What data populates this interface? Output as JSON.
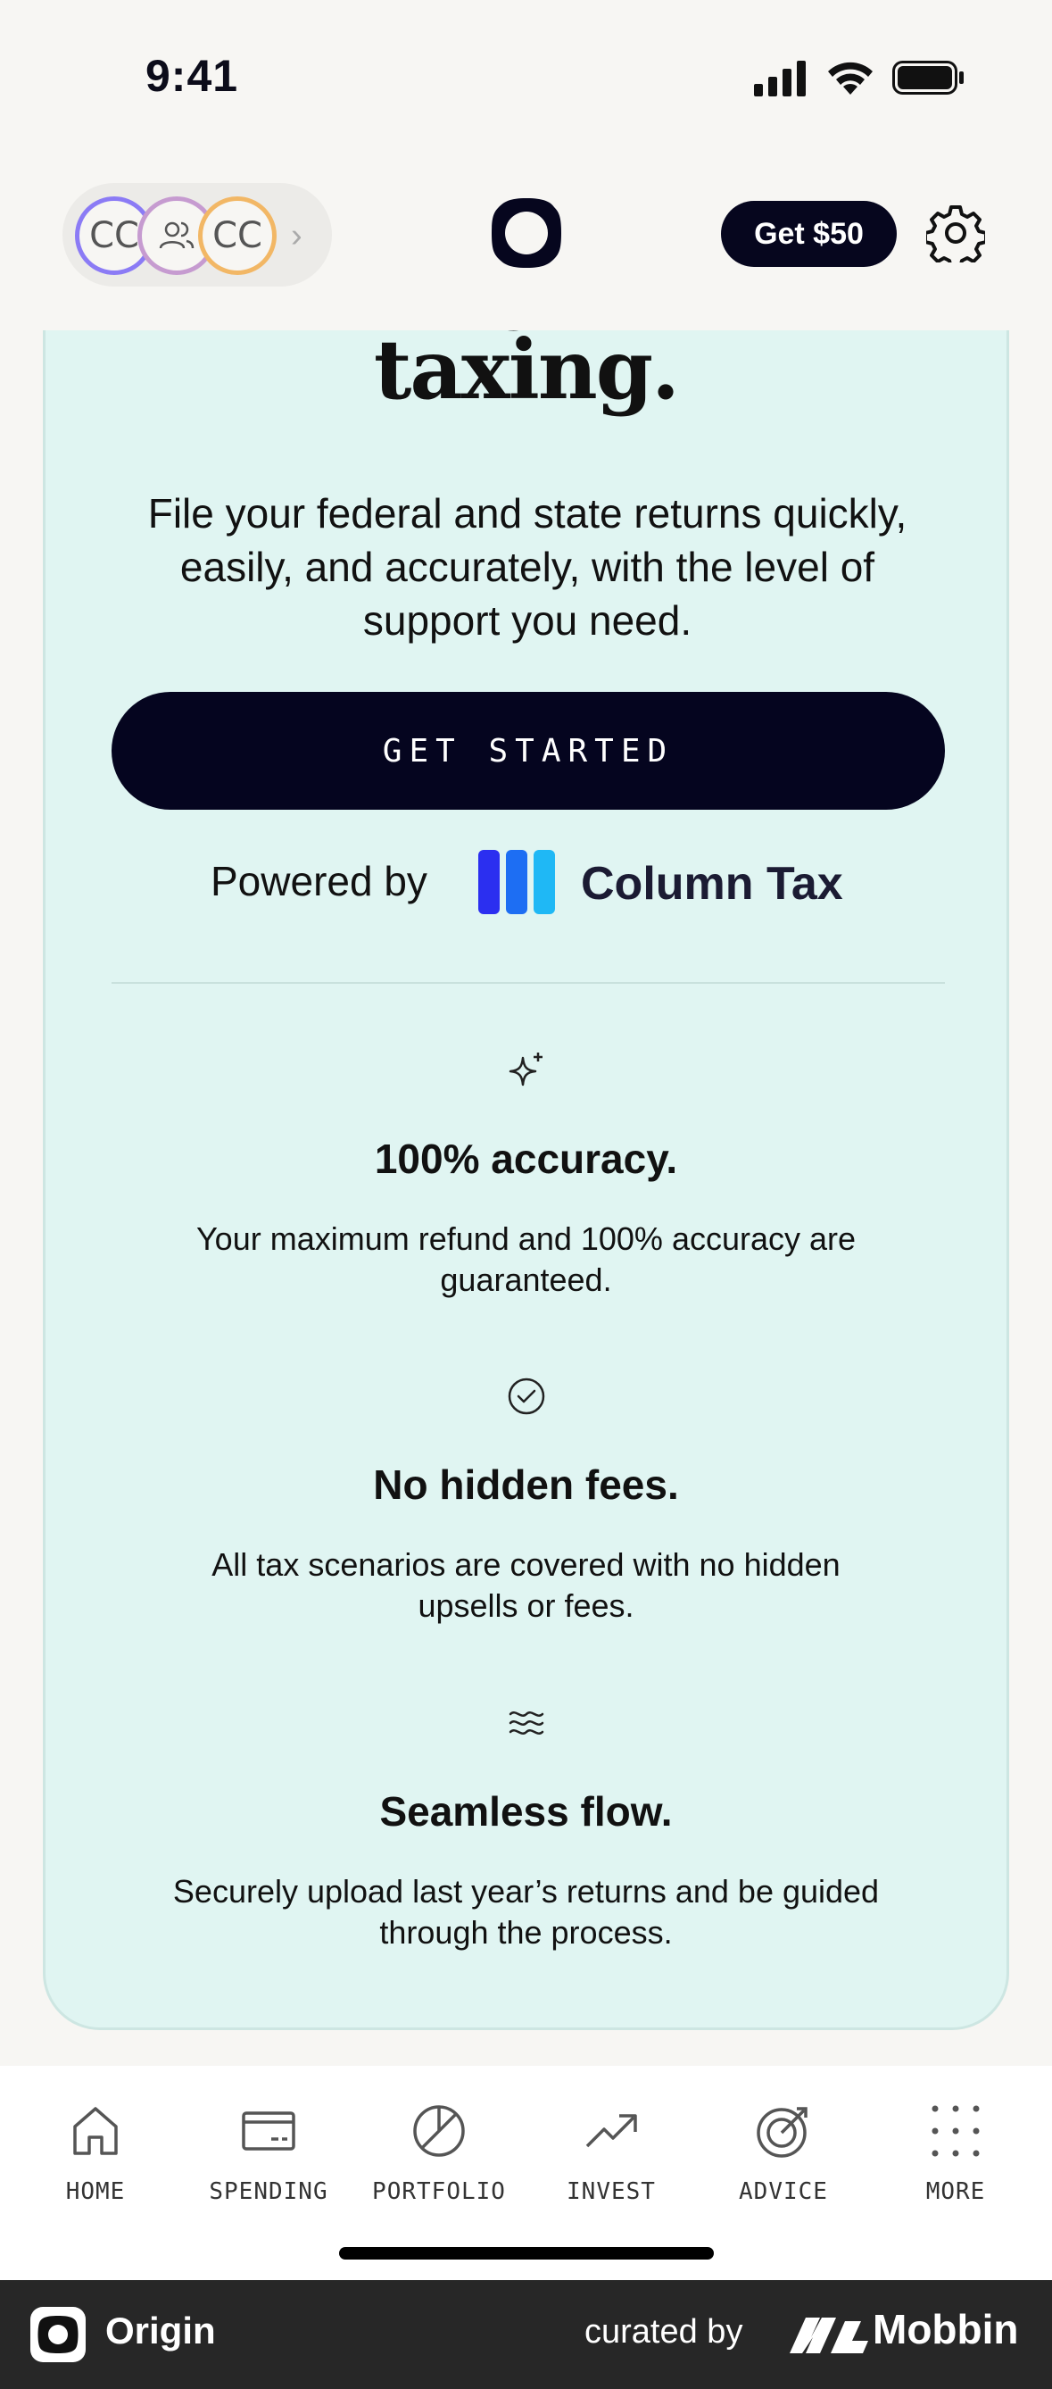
{
  "status_bar": {
    "time": "9:41"
  },
  "header": {
    "avatars": [
      "CC",
      "",
      "CC"
    ],
    "referral_button": "Get $50"
  },
  "card": {
    "headline_partial": "g",
    "headline": "taxing.",
    "intro": "File your federal and state returns quickly, easily, and accurately, with the level of support you need.",
    "cta": "GET STARTED",
    "powered_by": "Powered by",
    "partner": "Column Tax",
    "features": [
      {
        "icon": "sparkle-icon",
        "title": "100% accuracy.",
        "desc": "Your maximum refund and 100% accuracy are guaranteed."
      },
      {
        "icon": "check-circle-icon",
        "title": "No hidden fees.",
        "desc": "All tax scenarios are covered with no hidden upsells or fees."
      },
      {
        "icon": "waves-icon",
        "title": "Seamless flow.",
        "desc": "Securely upload last year’s returns and be guided through the process."
      }
    ]
  },
  "nav": {
    "items": [
      {
        "label": "HOME",
        "icon": "home-icon"
      },
      {
        "label": "SPENDING",
        "icon": "card-icon"
      },
      {
        "label": "PORTFOLIO",
        "icon": "pie-chart-icon"
      },
      {
        "label": "INVEST",
        "icon": "trend-up-icon"
      },
      {
        "label": "ADVICE",
        "icon": "target-icon"
      },
      {
        "label": "MORE",
        "icon": "grid-dots-icon"
      }
    ]
  },
  "footer": {
    "app_name": "Origin",
    "curated_by": "curated by",
    "brand": "Mobbin"
  },
  "colors": {
    "card_bg": "#e0f5f2",
    "primary_dark": "#05051f",
    "column_blue": "#2b2ff0",
    "column_cyan": "#1fb8f5"
  }
}
